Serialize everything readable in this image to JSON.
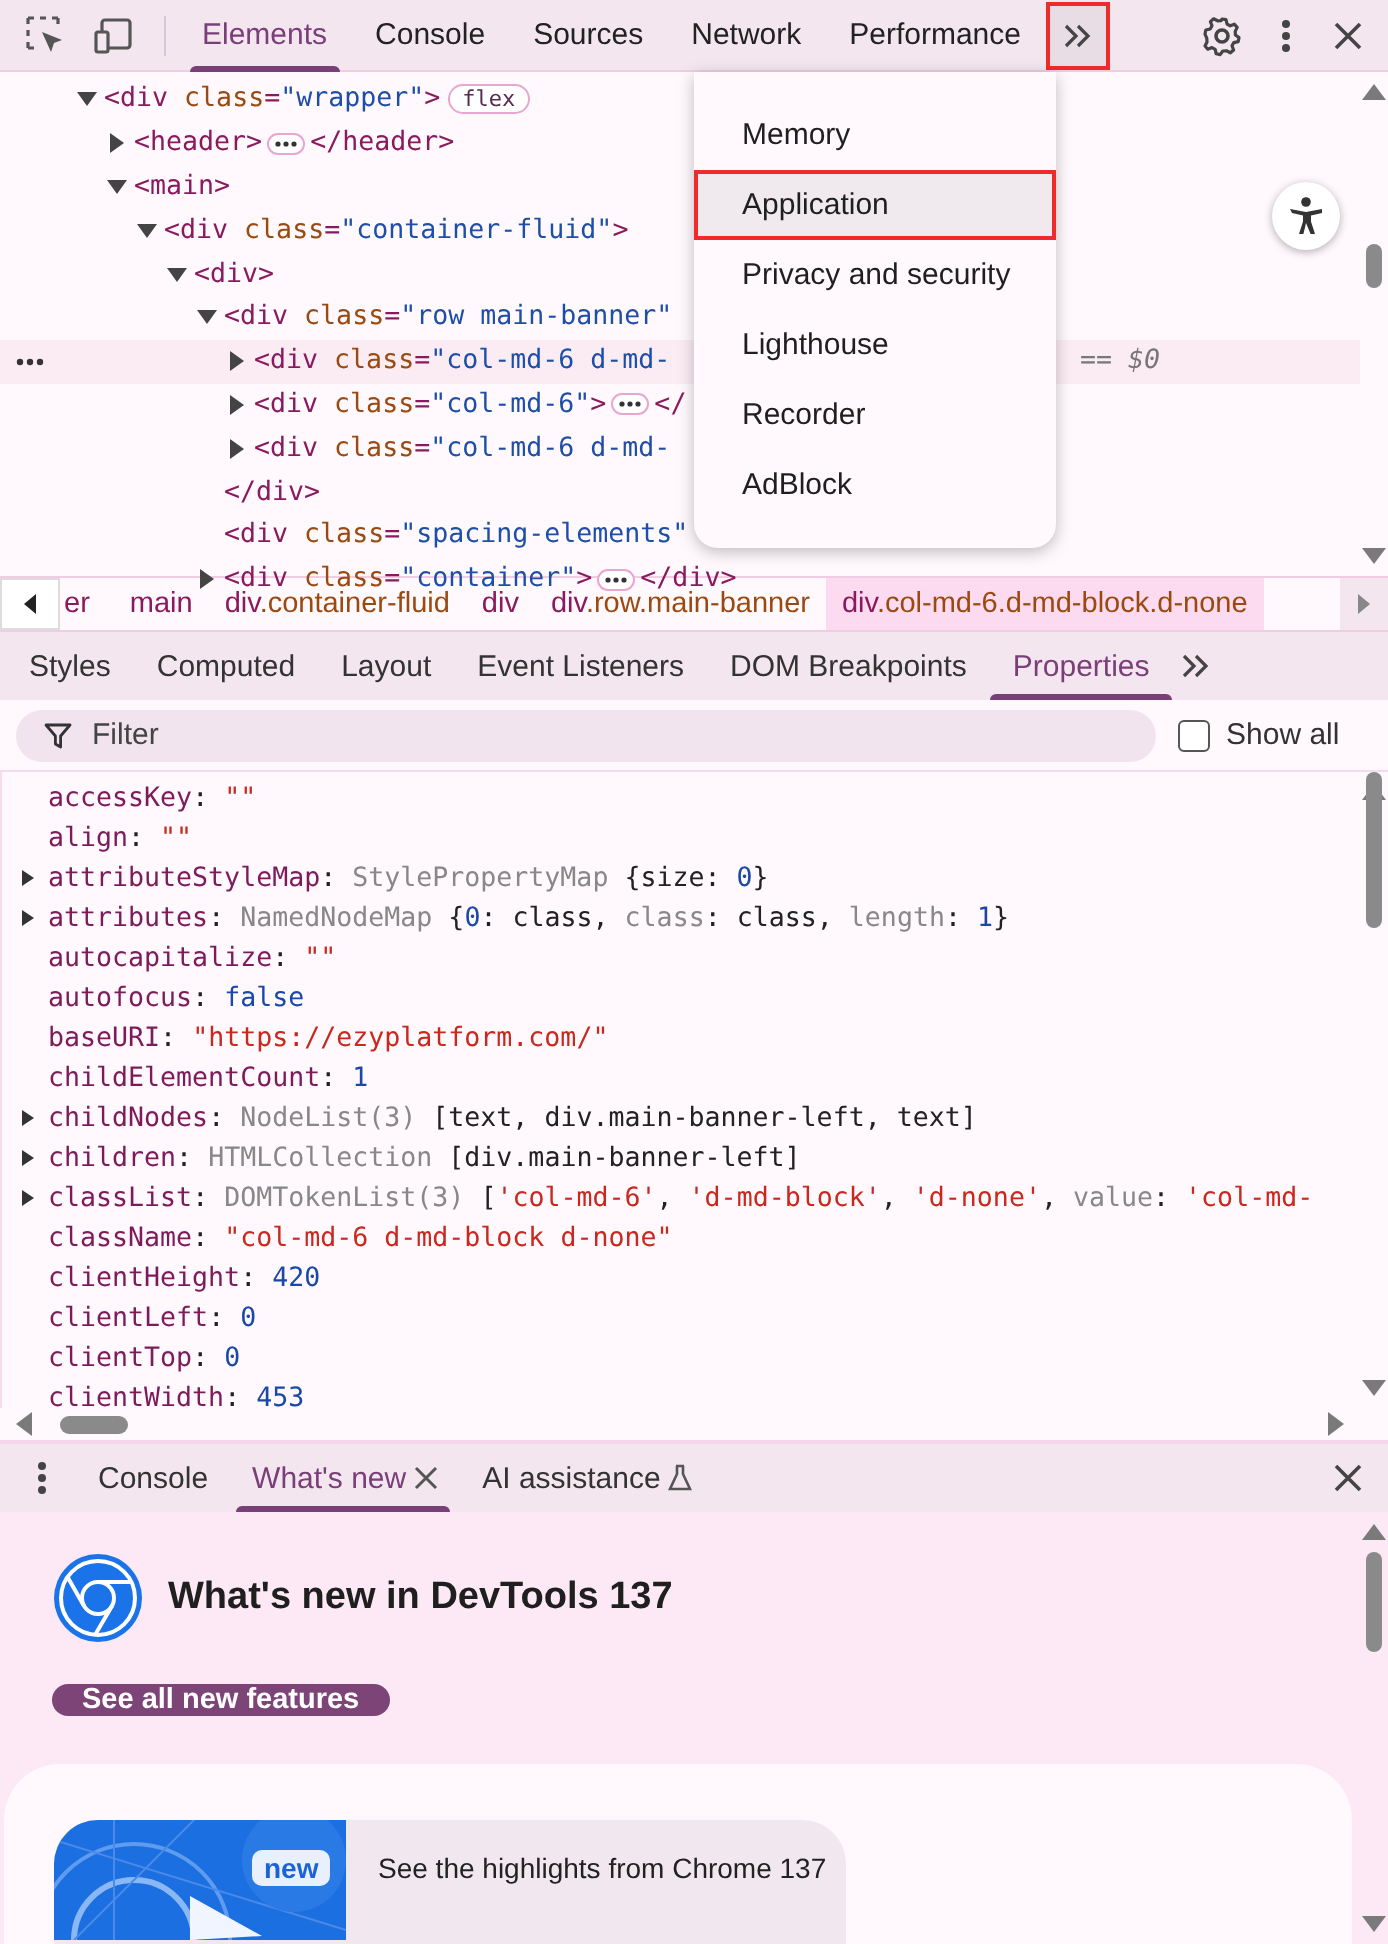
{
  "toolbar": {
    "tabs": [
      {
        "label": "Elements",
        "selected": true
      },
      {
        "label": "Console",
        "selected": false
      },
      {
        "label": "Sources",
        "selected": false
      },
      {
        "label": "Network",
        "selected": false
      },
      {
        "label": "Performance",
        "selected": false
      }
    ],
    "overflow_highlighted": true
  },
  "more_tools_menu": {
    "items": [
      {
        "label": "Memory",
        "highlighted": false
      },
      {
        "label": "Application",
        "highlighted": true
      },
      {
        "label": "Privacy and security",
        "highlighted": false
      },
      {
        "label": "Lighthouse",
        "highlighted": false
      },
      {
        "label": "Recorder",
        "highlighted": false
      },
      {
        "label": "AdBlock",
        "highlighted": false
      }
    ]
  },
  "dom_tree": [
    {
      "open": "<div class=\"wrapper\">",
      "badge": "flex",
      "kind": "expanded",
      "selected": false,
      "children": [
        {
          "open": "<header>",
          "ellipsis": true,
          "close": "</header>",
          "kind": "collapsed",
          "selected": false
        },
        {
          "open": "<main>",
          "kind": "expanded",
          "selected": false,
          "children": [
            {
              "open": "<div class=\"container-fluid\">",
              "kind": "expanded",
              "selected": false,
              "children": [
                {
                  "open": "<div>",
                  "kind": "expanded",
                  "selected": false,
                  "children": [
                    {
                      "open": "<div class=\"row main-banner\"",
                      "kind": "expanded",
                      "selected": false,
                      "close_line": "</div>",
                      "children": [
                        {
                          "open": "<div class=\"col-md-6 d-md-",
                          "kind": "collapsed",
                          "selected": true,
                          "suffix": "== $0"
                        },
                        {
                          "open": "<div class=\"col-md-6\">",
                          "ellipsis": true,
                          "close": "</",
                          "kind": "collapsed",
                          "selected": false
                        },
                        {
                          "open": "<div class=\"col-md-6 d-md-",
                          "kind": "collapsed",
                          "selected": false
                        }
                      ]
                    },
                    {
                      "open": "<div class=\"spacing-elements\"",
                      "kind": "leaf",
                      "selected": false
                    },
                    {
                      "open": "<div class=\"container\">",
                      "ellipsis": true,
                      "close": "</div>",
                      "kind": "collapsed",
                      "selected": false
                    }
                  ]
                }
              ]
            }
          ]
        }
      ]
    }
  ],
  "breadcrumbs": [
    {
      "label": "er",
      "selected": false
    },
    {
      "label": "main",
      "selected": false
    },
    {
      "label": "div.container-fluid",
      "selected": false
    },
    {
      "label": "div",
      "selected": false
    },
    {
      "label": "div.row.main-banner",
      "selected": false
    },
    {
      "label": "div.col-md-6.d-md-block.d-none",
      "selected": true
    }
  ],
  "sidebar_tabs": [
    {
      "label": "Styles",
      "selected": false
    },
    {
      "label": "Computed",
      "selected": false
    },
    {
      "label": "Layout",
      "selected": false
    },
    {
      "label": "Event Listeners",
      "selected": false
    },
    {
      "label": "DOM Breakpoints",
      "selected": false
    },
    {
      "label": "Properties",
      "selected": true
    }
  ],
  "filter": {
    "placeholder": "Filter",
    "show_all": {
      "label": "Show all",
      "checked": false
    }
  },
  "properties": [
    {
      "text": "accessKey: \"\"",
      "expandable": false
    },
    {
      "text": "align: \"\"",
      "expandable": false
    },
    {
      "text": "attributeStyleMap: StylePropertyMap {size: 0}",
      "expandable": true
    },
    {
      "text": "attributes: NamedNodeMap {0: class, class: class, length: 1}",
      "expandable": true
    },
    {
      "text": "autocapitalize: \"\"",
      "expandable": false
    },
    {
      "text": "autofocus: false",
      "expandable": false
    },
    {
      "text": "baseURI: \"https://ezyplatform.com/\"",
      "expandable": false
    },
    {
      "text": "childElementCount: 1",
      "expandable": false
    },
    {
      "text": "childNodes: NodeList(3) [text, div.main-banner-left, text]",
      "expandable": true
    },
    {
      "text": "children: HTMLCollection [div.main-banner-left]",
      "expandable": true
    },
    {
      "text": "classList: DOMTokenList(3) ['col-md-6', 'd-md-block', 'd-none', value: 'col-md-",
      "expandable": true
    },
    {
      "text": "className: \"col-md-6 d-md-block d-none\"",
      "expandable": false
    },
    {
      "text": "clientHeight: 420",
      "expandable": false
    },
    {
      "text": "clientLeft: 0",
      "expandable": false
    },
    {
      "text": "clientTop: 0",
      "expandable": false
    },
    {
      "text": "clientWidth: 453",
      "expandable": false
    }
  ],
  "drawer": {
    "tabs": [
      {
        "label": "Console",
        "selected": false,
        "kind": "plain"
      },
      {
        "label": "What's new",
        "selected": true,
        "kind": "closable"
      },
      {
        "label": "AI assistance",
        "selected": false,
        "kind": "experimental"
      }
    ],
    "whats_new": {
      "title": "What's new in DevTools 137",
      "button": "See all new features",
      "highlight": {
        "badge": "new",
        "text": "See the highlights from Chrome 137"
      }
    }
  }
}
